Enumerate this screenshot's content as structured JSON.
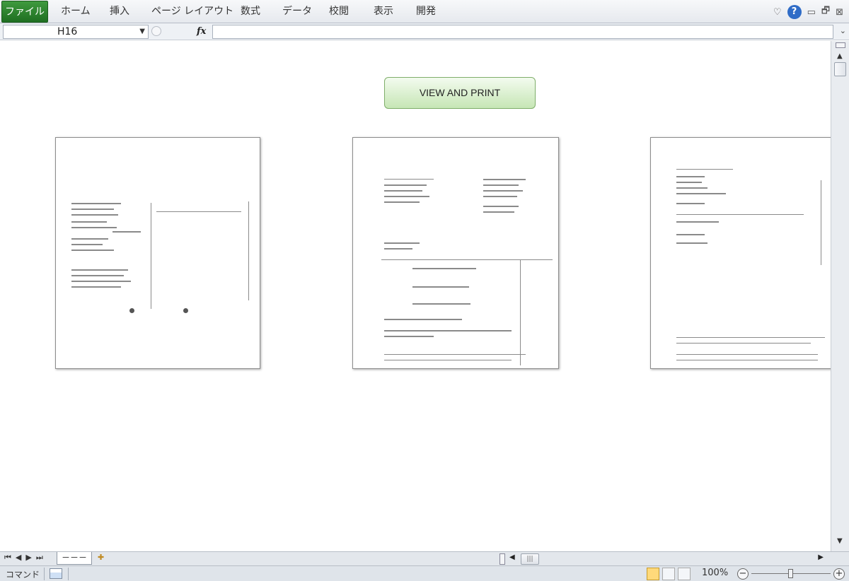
{
  "ribbon": {
    "tabs": [
      "ファイル",
      "ホーム",
      "挿入",
      "ページ レイアウト",
      "数式",
      "データ",
      "校閲",
      "表示",
      "開発"
    ]
  },
  "formula_bar": {
    "name_box": "H16",
    "fx_label": "fx",
    "formula": ""
  },
  "sheet": {
    "button_label": "VIEW AND PRINT",
    "thumbnails": [
      "page-1",
      "page-2",
      "page-3"
    ]
  },
  "sheet_tabs": {
    "active_tab": "－－－"
  },
  "status": {
    "mode": "コマンド",
    "zoom": "100%"
  },
  "icons": {
    "help": "?",
    "minimize": "▭",
    "restore": "🗗",
    "close": "⊠"
  },
  "colors": {
    "file_tab": "#2a7e2d",
    "button_bg": "#c6e6b5"
  }
}
